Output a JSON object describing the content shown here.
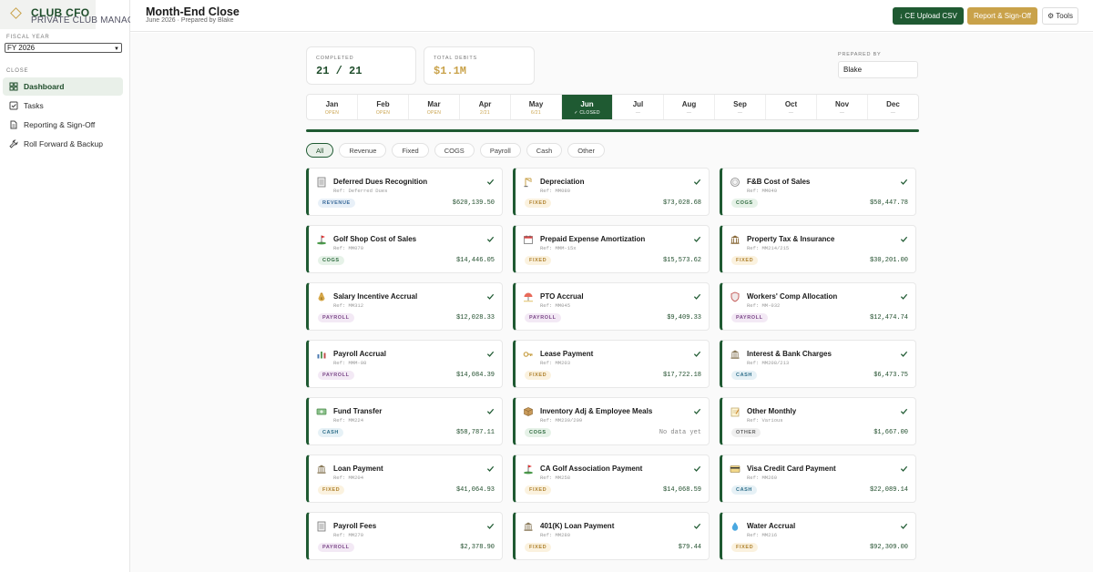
{
  "brand": {
    "title": "CLUB CFO",
    "subtitle": "PRIVATE CLUB MANAGEMENT"
  },
  "sidebar": {
    "fiscal_year_label": "FISCAL YEAR",
    "fiscal_year_value": "FY 2026",
    "section_label": "CLOSE",
    "items": [
      {
        "label": "Dashboard",
        "icon": "grid-icon",
        "active": true
      },
      {
        "label": "Tasks",
        "icon": "checkbox-icon",
        "active": false
      },
      {
        "label": "Reporting & Sign-Off",
        "icon": "document-icon",
        "active": false
      },
      {
        "label": "Roll Forward & Backup",
        "icon": "wrench-icon",
        "active": false
      }
    ]
  },
  "header": {
    "title": "Month-End Close",
    "subtitle": "June 2026 · Prepared by Blake",
    "upload_label": "↓ CE Upload CSV",
    "report_label": "Report & Sign-Off",
    "tools_label": "⚙ Tools"
  },
  "stats": {
    "completed_label": "COMPLETED",
    "completed_value": "21 / 21",
    "debits_label": "TOTAL DEBITS",
    "debits_value": "$1.1M",
    "prepared_label": "PREPARED BY",
    "prepared_value": "Blake"
  },
  "colors": {
    "brand_green": "#1f5a32",
    "gold": "#c9a24a"
  },
  "months": [
    {
      "name": "Jan",
      "status": "OPEN",
      "color": "#c9a24a"
    },
    {
      "name": "Feb",
      "status": "OPEN",
      "color": "#c9a24a"
    },
    {
      "name": "Mar",
      "status": "OPEN",
      "color": "#c9a24a"
    },
    {
      "name": "Apr",
      "status": "2/21",
      "color": "#c9a24a"
    },
    {
      "name": "May",
      "status": "6/21",
      "color": "#c9a24a"
    },
    {
      "name": "Jun",
      "status": "✓ CLOSED",
      "color": "#ffffff",
      "active": true
    },
    {
      "name": "Jul",
      "status": "—",
      "color": "#aaaaaa"
    },
    {
      "name": "Aug",
      "status": "—",
      "color": "#aaaaaa"
    },
    {
      "name": "Sep",
      "status": "—",
      "color": "#aaaaaa"
    },
    {
      "name": "Oct",
      "status": "—",
      "color": "#aaaaaa"
    },
    {
      "name": "Nov",
      "status": "—",
      "color": "#aaaaaa"
    },
    {
      "name": "Dec",
      "status": "—",
      "color": "#aaaaaa"
    }
  ],
  "filters": [
    "All",
    "Revenue",
    "Fixed",
    "COGS",
    "Payroll",
    "Cash",
    "Other"
  ],
  "tag_styles": {
    "REVENUE": {
      "bg": "#e8f0f8",
      "fg": "#3a6a9a"
    },
    "FIXED": {
      "bg": "#fbf2df",
      "fg": "#b08330"
    },
    "COGS": {
      "bg": "#e6f2e8",
      "fg": "#2f6b3f"
    },
    "PAYROLL": {
      "bg": "#f3e9f5",
      "fg": "#7d4a8a"
    },
    "CASH": {
      "bg": "#e6f1f6",
      "fg": "#2f6f8a"
    },
    "OTHER": {
      "bg": "#efefef",
      "fg": "#666666"
    }
  },
  "tasks": [
    {
      "title": "Deferred Dues Recognition",
      "ref": "Ref: Deferred Dues",
      "tag": "REVENUE",
      "amount": "$620,139.50",
      "icon": "ledger-icon"
    },
    {
      "title": "Depreciation",
      "ref": "Ref: MM080",
      "tag": "FIXED",
      "amount": "$73,028.68",
      "icon": "crane-icon"
    },
    {
      "title": "F&B Cost of Sales",
      "ref": "Ref: MM040",
      "tag": "COGS",
      "amount": "$50,447.78",
      "icon": "plate-icon"
    },
    {
      "title": "Golf Shop Cost of Sales",
      "ref": "Ref: MM070",
      "tag": "COGS",
      "amount": "$14,446.05",
      "icon": "golf-flag-icon"
    },
    {
      "title": "Prepaid Expense Amortization",
      "ref": "Ref: MMM-15x",
      "tag": "FIXED",
      "amount": "$15,573.62",
      "icon": "calendar-icon"
    },
    {
      "title": "Property Tax & Insurance",
      "ref": "Ref: MM214/215",
      "tag": "FIXED",
      "amount": "$30,201.00",
      "icon": "building-icon"
    },
    {
      "title": "Salary Incentive Accrual",
      "ref": "Ref: MM312",
      "tag": "PAYROLL",
      "amount": "$12,028.33",
      "icon": "money-bag-icon"
    },
    {
      "title": "PTO Accrual",
      "ref": "Ref: MM045",
      "tag": "PAYROLL",
      "amount": "$9,409.33",
      "icon": "beach-icon"
    },
    {
      "title": "Workers' Comp Allocation",
      "ref": "Ref: MM-032",
      "tag": "PAYROLL",
      "amount": "$12,474.74",
      "icon": "shield-icon"
    },
    {
      "title": "Payroll Accrual",
      "ref": "Ref: MMM-08",
      "tag": "PAYROLL",
      "amount": "$14,084.39",
      "icon": "bar-chart-icon"
    },
    {
      "title": "Lease Payment",
      "ref": "Ref: MM203",
      "tag": "FIXED",
      "amount": "$17,722.18",
      "icon": "key-icon"
    },
    {
      "title": "Interest & Bank Charges",
      "ref": "Ref: MM208/213",
      "tag": "CASH",
      "amount": "$6,473.75",
      "icon": "bank-icon"
    },
    {
      "title": "Fund Transfer",
      "ref": "Ref: MM224",
      "tag": "CASH",
      "amount": "$58,787.11",
      "icon": "cash-icon"
    },
    {
      "title": "Inventory Adj & Employee Meals",
      "ref": "Ref: MM230/209",
      "tag": "COGS",
      "amount": "No data yet",
      "icon": "box-icon",
      "muted": true
    },
    {
      "title": "Other Monthly",
      "ref": "Ref: Various",
      "tag": "OTHER",
      "amount": "$1,667.00",
      "icon": "memo-icon"
    },
    {
      "title": "Loan Payment",
      "ref": "Ref: MM204",
      "tag": "FIXED",
      "amount": "$41,064.93",
      "icon": "bank-icon"
    },
    {
      "title": "CA Golf Association Payment",
      "ref": "Ref: MM258",
      "tag": "FIXED",
      "amount": "$14,068.59",
      "icon": "golf-flag-icon"
    },
    {
      "title": "Visa Credit Card Payment",
      "ref": "Ref: MM260",
      "tag": "CASH",
      "amount": "$22,089.14",
      "icon": "credit-card-icon"
    },
    {
      "title": "Payroll Fees",
      "ref": "Ref: MM270",
      "tag": "PAYROLL",
      "amount": "$2,378.90",
      "icon": "ledger-icon"
    },
    {
      "title": "401(K) Loan Payment",
      "ref": "Ref: MM280",
      "tag": "FIXED",
      "amount": "$79.44",
      "icon": "bank-icon"
    },
    {
      "title": "Water Accrual",
      "ref": "Ref: MM216",
      "tag": "FIXED",
      "amount": "$92,309.00",
      "icon": "water-drop-icon"
    }
  ]
}
